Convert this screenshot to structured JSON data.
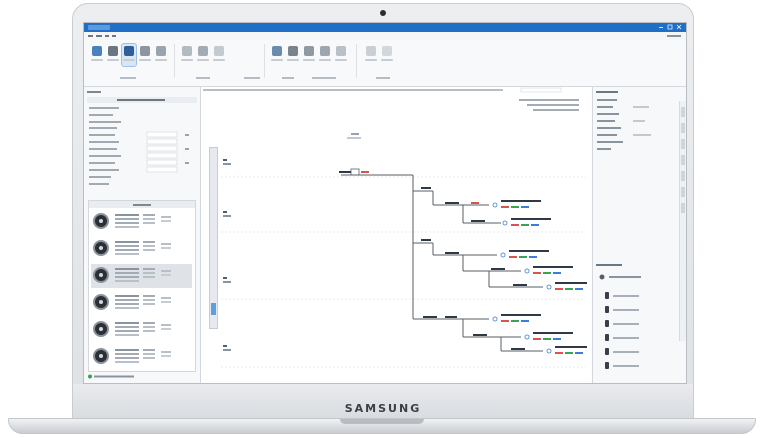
{
  "hardware": {
    "brand": "SAMSUNG"
  },
  "app": {
    "window_title": "",
    "menu": [],
    "ribbon_groups": [],
    "left_panel_title": "",
    "right_panel_title": "",
    "breadcrumb": ""
  },
  "colors": {
    "titlebar": "#1f6fc6",
    "accent": "#5f9fe0",
    "tree_line": "#5a5f66",
    "node_label_dark": "#2f3a46",
    "node_label_red": "#d9534f",
    "node_label_green": "#3aa35a",
    "node_label_blue": "#3b7dd8"
  },
  "icons": {
    "ribbon": [
      "open-icon",
      "save-icon",
      "grid-icon",
      "breaker-icon",
      "device-icon",
      "cable-icon",
      "panel-icon",
      "report-icon",
      "calc-icon",
      "export-icon",
      "print-icon",
      "help-icon"
    ],
    "devices": [
      "device-round-icon",
      "device-round-icon",
      "device-round-icon",
      "device-round-icon",
      "device-round-icon",
      "device-round-icon"
    ]
  }
}
